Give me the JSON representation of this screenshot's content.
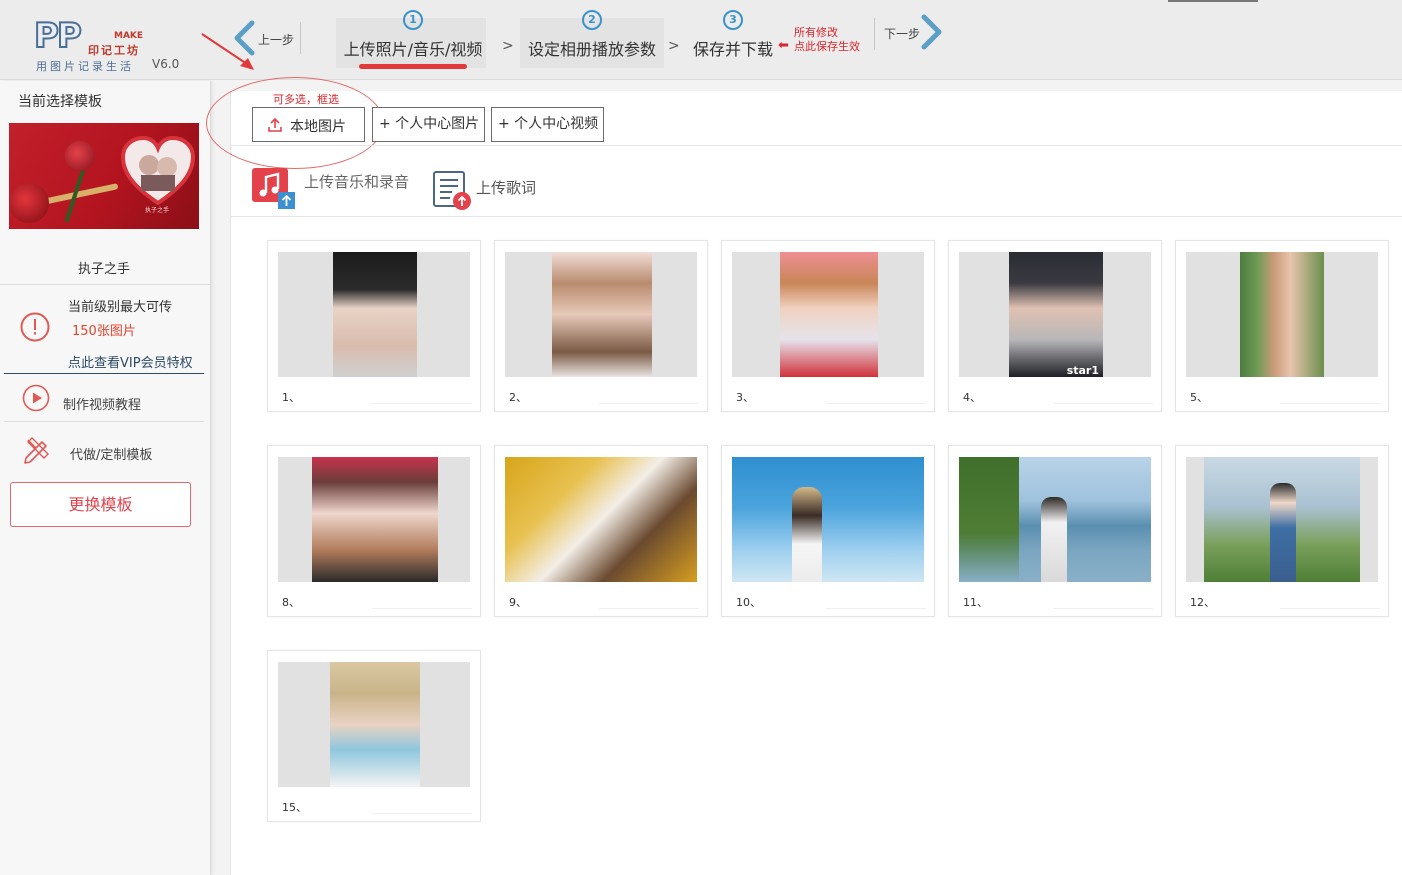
{
  "header": {
    "logo": {
      "letters": "PP",
      "make": "MAKE",
      "brand": "印记工坊",
      "slogan": "用图片记录生活",
      "version": "V6.0"
    },
    "prev_label": "上一步",
    "next_label": "下一步",
    "steps": [
      {
        "num": "1",
        "label": "上传照片/音乐/视频"
      },
      {
        "num": "2",
        "label": "设定相册播放参数"
      },
      {
        "num": "3",
        "label": "保存并下载"
      }
    ],
    "step_separator": ">",
    "save_note_line1": "所有修改",
    "save_note_line2": "点此保存生效",
    "save_note_arrow": "⬅",
    "accent_color": "#e23a3a",
    "step_color": "#3b94c9"
  },
  "sidebar": {
    "title": "当前选择模板",
    "template_name": "执子之手",
    "template_thumb_text": "执子之手",
    "limit_label": "当前级别最大可传",
    "limit_count": "150张图片",
    "vip_link": "点此查看VIP会员特权",
    "tutorial_label": "制作视频教程",
    "custom_label": "代做/定制模板",
    "change_button": "更换模板"
  },
  "main": {
    "multi_select_tip": "可多选，框选",
    "local_button": "本地图片",
    "personal_pic_button": "+ 个人中心图片",
    "personal_vid_button": "+ 个人中心视频",
    "upload_music": "上传音乐和录音",
    "upload_lyrics": "上传歌词",
    "photos": [
      {
        "caption": "1、",
        "icon": "portrait-black-hat"
      },
      {
        "caption": "2、",
        "icon": "portrait-long-hair"
      },
      {
        "caption": "3、",
        "icon": "portrait-braids-pink"
      },
      {
        "caption": "4、",
        "icon": "portrait-black-jacket",
        "watermark": "star1"
      },
      {
        "caption": "5、",
        "icon": "portrait-glasses-green"
      },
      {
        "caption": "8、",
        "icon": "portrait-flower-crown"
      },
      {
        "caption": "9、",
        "icon": "portrait-autumn-leaves"
      },
      {
        "caption": "10、",
        "icon": "portrait-sky-hat"
      },
      {
        "caption": "11、",
        "icon": "portrait-seaside"
      },
      {
        "caption": "12、",
        "icon": "portrait-terrace"
      },
      {
        "caption": "15、",
        "icon": "portrait-straw-hat"
      }
    ]
  }
}
